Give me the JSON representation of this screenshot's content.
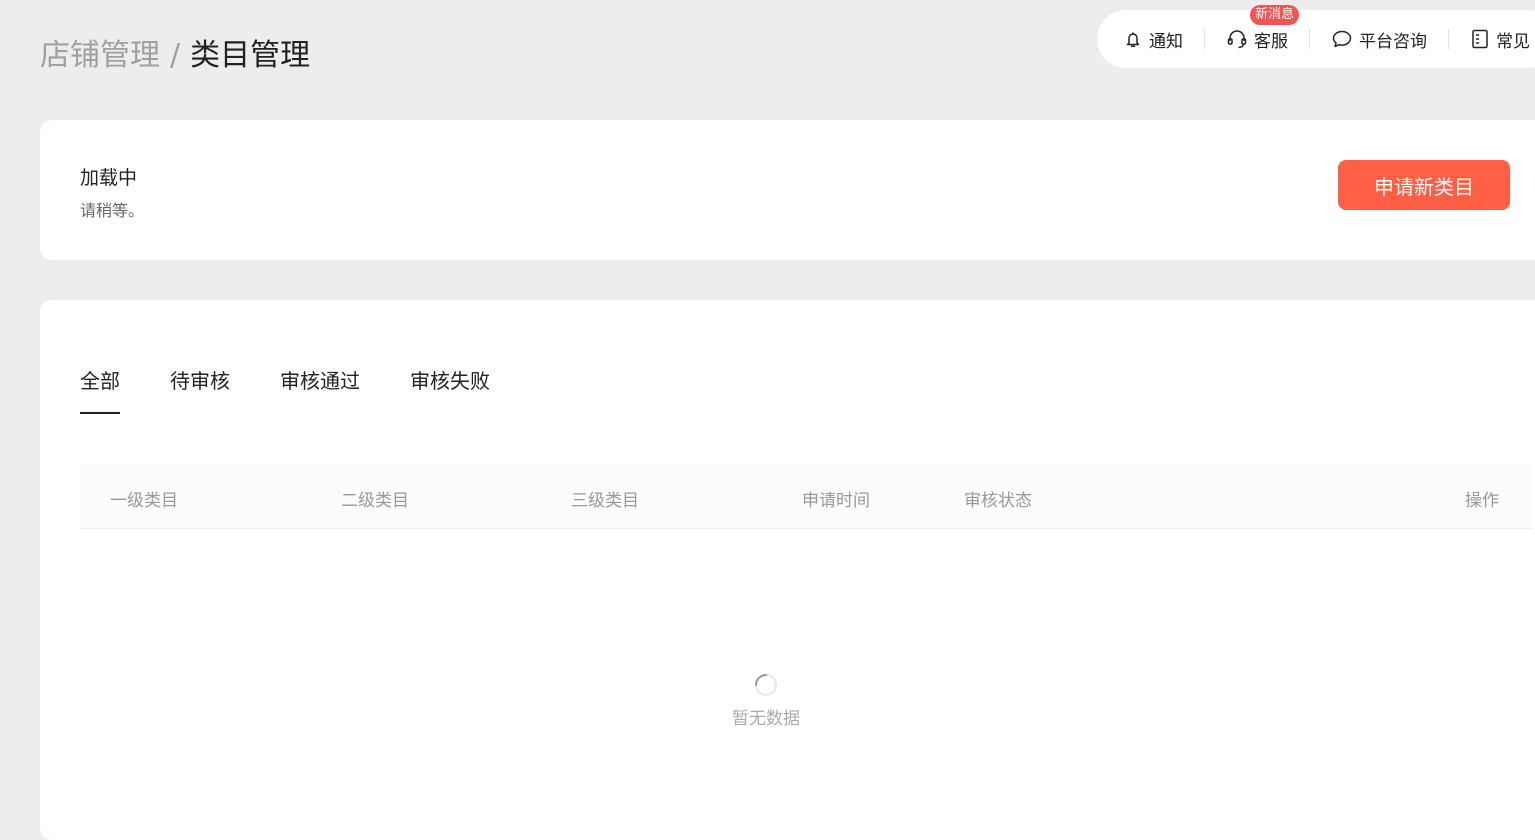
{
  "breadcrumb": {
    "parent": "店铺管理",
    "separator": "/",
    "current": "类目管理"
  },
  "topbar": {
    "notify": {
      "label": "通知",
      "icon": "bell-icon"
    },
    "service": {
      "label": "客服",
      "icon": "headset-icon",
      "badge": "新消息"
    },
    "consult": {
      "label": "平台咨询",
      "icon": "chat-bubble-icon"
    },
    "faq": {
      "label": "常见",
      "icon": "document-icon"
    }
  },
  "status": {
    "title": "加载中",
    "subtitle": "请稍等。"
  },
  "actions": {
    "apply_label": "申请新类目"
  },
  "tabs": [
    {
      "label": "全部",
      "active": true
    },
    {
      "label": "待审核",
      "active": false
    },
    {
      "label": "审核通过",
      "active": false
    },
    {
      "label": "审核失败",
      "active": false
    }
  ],
  "table": {
    "columns": [
      "一级类目",
      "二级类目",
      "三级类目",
      "申请时间",
      "审核状态",
      "操作"
    ],
    "rows": [],
    "empty_text": "暂无数据"
  },
  "colors": {
    "accent": "#ff5f45",
    "badge": "#f25454",
    "background": "#ededed"
  }
}
